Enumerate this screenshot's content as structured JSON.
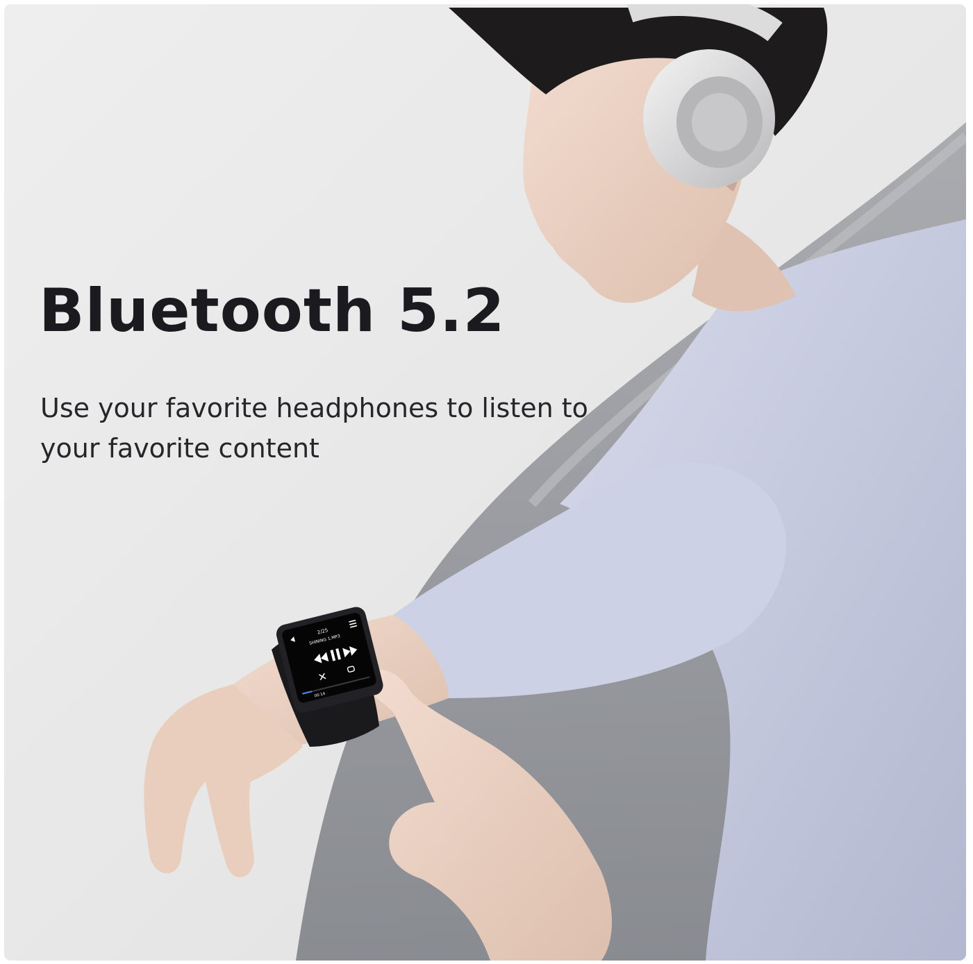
{
  "headline": "Bluetooth 5.2",
  "subline": "Use your favorite headphones to listen to your favorite content",
  "player": {
    "track_index": "2/25",
    "track_name": "SHINING 1.MP3",
    "time": "00:14"
  },
  "colors": {
    "headline": "#1b1b1f",
    "shirt": "#c7cbe0",
    "background": "#ececec",
    "road": "#8d9096"
  },
  "icons": [
    "headphones-icon",
    "menu-icon",
    "back-icon",
    "rewind-icon",
    "pause-icon",
    "fast-forward-icon",
    "shuffle-icon",
    "repeat-icon"
  ]
}
